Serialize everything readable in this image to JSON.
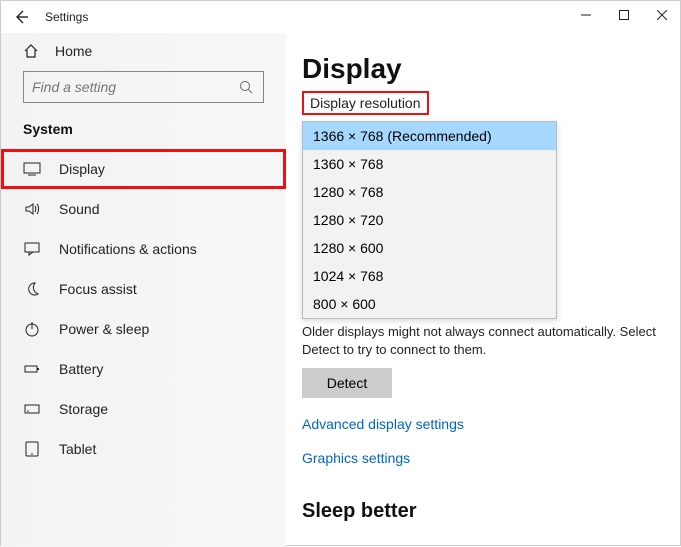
{
  "app": {
    "title": "Settings"
  },
  "sidebar": {
    "home": "Home",
    "search_placeholder": "Find a setting",
    "section": "System",
    "items": [
      {
        "label": "Display",
        "icon": "monitor-icon",
        "selected": true
      },
      {
        "label": "Sound",
        "icon": "speaker-icon"
      },
      {
        "label": "Notifications & actions",
        "icon": "chat-icon"
      },
      {
        "label": "Focus assist",
        "icon": "moon-icon"
      },
      {
        "label": "Power & sleep",
        "icon": "power-icon"
      },
      {
        "label": "Battery",
        "icon": "battery-icon"
      },
      {
        "label": "Storage",
        "icon": "storage-icon"
      },
      {
        "label": "Tablet",
        "icon": "tablet-icon"
      }
    ]
  },
  "content": {
    "heading": "Display",
    "label": "Display resolution",
    "options": [
      "1366 × 768 (Recommended)",
      "1360 × 768",
      "1280 × 768",
      "1280 × 720",
      "1280 × 600",
      "1024 × 768",
      "800 × 600"
    ],
    "help": "Older displays might not always connect automatically. Select Detect to try to connect to them.",
    "detect": "Detect",
    "link1": "Advanced display settings",
    "link2": "Graphics settings",
    "sleep_heading": "Sleep better"
  }
}
